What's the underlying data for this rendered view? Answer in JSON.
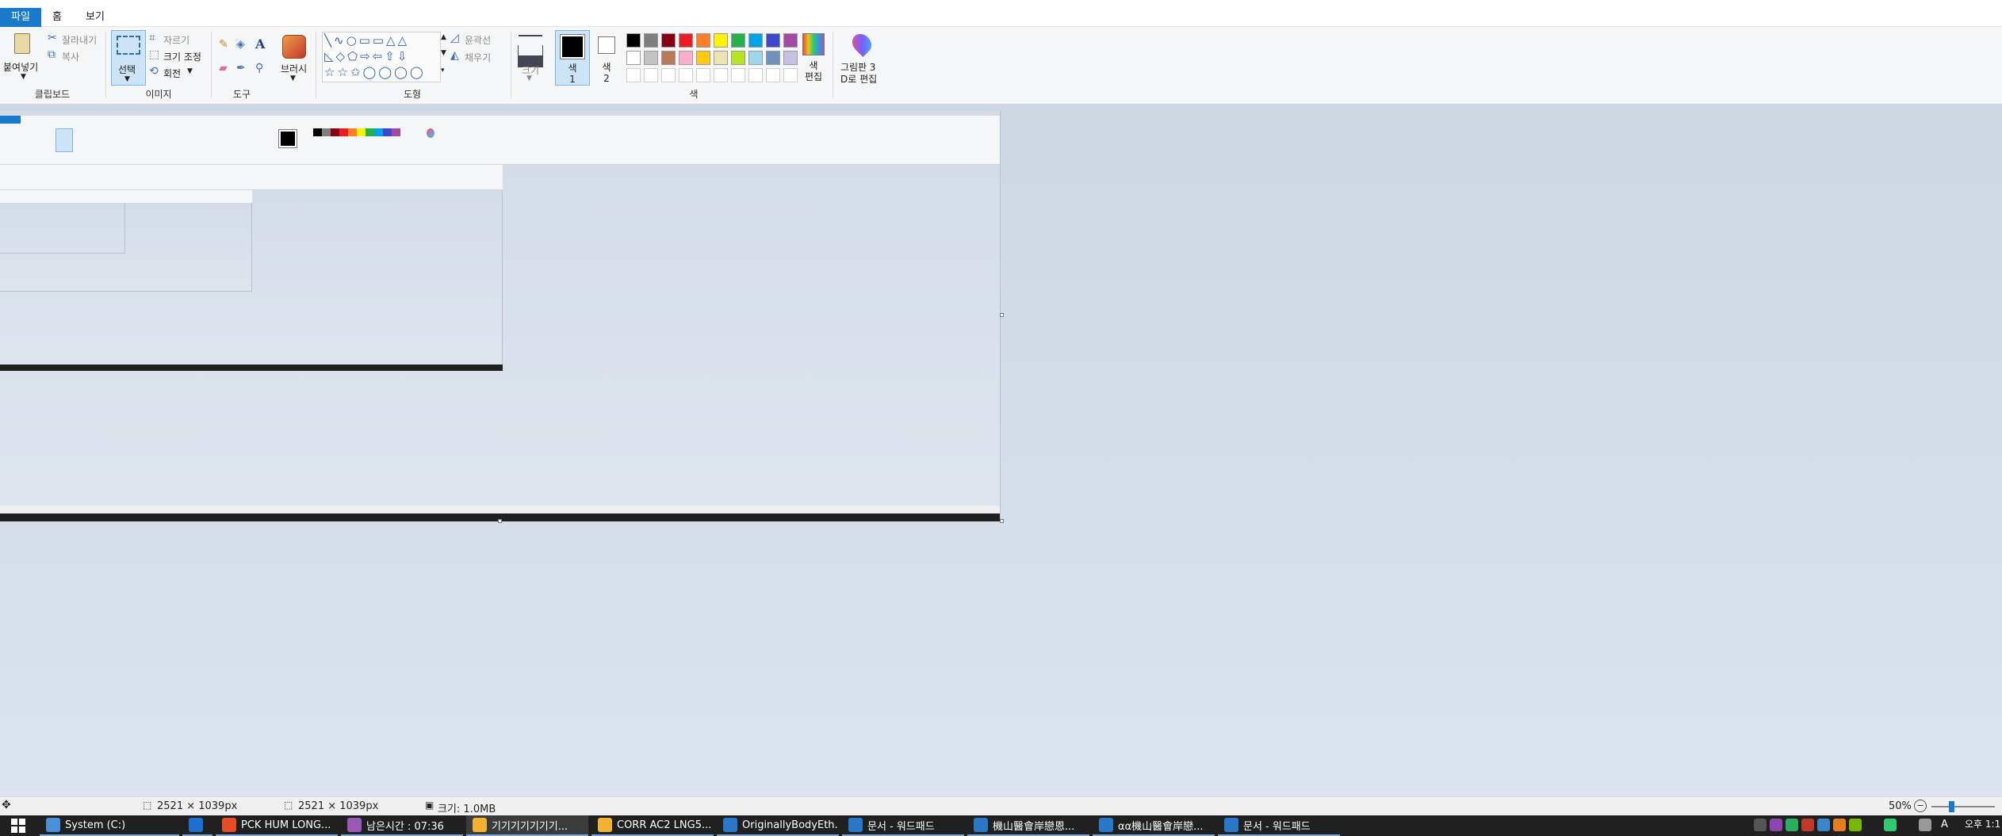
{
  "ribbon": {
    "tabs": {
      "file": "파일",
      "home": "홈",
      "view": "보기"
    },
    "clipboard": {
      "paste": "붙여넣기",
      "cut": "잘라내기",
      "copy": "복사",
      "group": "클립보드"
    },
    "image": {
      "select": "선택",
      "crop": "자르기",
      "resize": "크기 조정",
      "rotate": "회전",
      "group": "이미지"
    },
    "tools": {
      "group": "도구"
    },
    "brushes": {
      "label": "브러시"
    },
    "shapes": {
      "outline": "윤곽선",
      "fill": "채우기",
      "group": "도형"
    },
    "size": {
      "label": "크기"
    },
    "colors": {
      "color1": "색 1",
      "color2": "색 2",
      "edit": "색 편집",
      "group": "색",
      "palette_row1": [
        "#000000",
        "#7f7f7f",
        "#880015",
        "#ed1c24",
        "#ff7f27",
        "#fff200",
        "#22b14c",
        "#00a2e8",
        "#3f48cc",
        "#a349a4"
      ],
      "palette_row2": [
        "#ffffff",
        "#c3c3c3",
        "#b97a57",
        "#ffaec9",
        "#ffc90e",
        "#efe4b0",
        "#b5e61d",
        "#99d9ea",
        "#7092be",
        "#c8bfe7"
      ]
    },
    "paint3d": {
      "label_line1": "그림판 3",
      "label_line2": "D로 편집"
    }
  },
  "status": {
    "cursor": "2521 × 1039px",
    "selection": "2521 × 1039px",
    "filesize": "크기: 1.0MB",
    "zoom": "50%"
  },
  "taskbar": {
    "items": [
      {
        "label": "System (C:)",
        "color": "#4a90d9"
      },
      {
        "label": "",
        "color": "#1e6fd0"
      },
      {
        "label": "PCK HUM LONG...",
        "color": "#e44d26"
      },
      {
        "label": "남은시간 : 07:36",
        "color": "#9b59b6"
      },
      {
        "label": "기기기기기기기...",
        "color": "#f2b233"
      },
      {
        "label": "CORR AC2 LNG5...",
        "color": "#f2b233"
      },
      {
        "label": "OriginallyBodyEth...",
        "color": "#2b78c9"
      },
      {
        "label": "문서 - 워드패드",
        "color": "#2b78c9"
      },
      {
        "label": "機山醫會岸戀恩...",
        "color": "#2b78c9"
      },
      {
        "label": "αα機山醫會岸戀...",
        "color": "#2b78c9"
      },
      {
        "label": "문서 - 워드패드",
        "color": "#2b78c9"
      }
    ],
    "clock": "오후 1:1"
  }
}
